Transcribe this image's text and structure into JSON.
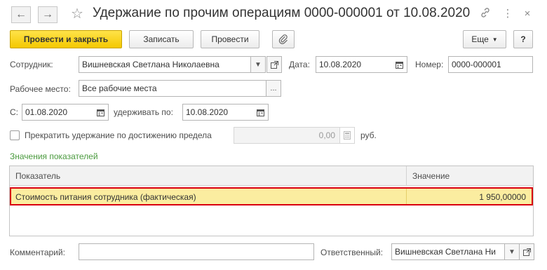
{
  "window": {
    "title": "Удержание по прочим операциям 0000-000001 от 10.08.2020"
  },
  "toolbar": {
    "post_close_label": "Провести и закрыть",
    "save_label": "Записать",
    "post_label": "Провести",
    "more_label": "Еще",
    "help_label": "?"
  },
  "form": {
    "employee_label": "Сотрудник:",
    "employee_value": "Вишневская Светлана Николаевна",
    "date_label": "Дата:",
    "date_value": "10.08.2020",
    "number_label": "Номер:",
    "number_value": "0000-000001",
    "workplace_label": "Рабочее место:",
    "workplace_value": "Все рабочие места",
    "from_label": "С:",
    "from_value": "01.08.2020",
    "withhold_to_label": "удерживать по:",
    "withhold_to_value": "10.08.2020",
    "stop_limit_label": "Прекратить удержание по достижению предела",
    "stop_limit_value": "0,00",
    "currency_label": "руб."
  },
  "indicators": {
    "section_label": "Значения показателей",
    "columns": [
      "Показатель",
      "Значение"
    ],
    "rows": [
      {
        "indicator": "Стоимость питания сотрудника (фактическая)",
        "value": "1 950,00000"
      }
    ]
  },
  "footer": {
    "comment_label": "Комментарий:",
    "comment_value": "",
    "responsible_label": "Ответственный:",
    "responsible_value": "Вишневская Светлана Ни"
  },
  "icons": {
    "back": "arrow-left-icon",
    "forward": "arrow-right-icon",
    "favorite": "star-icon",
    "link": "link-icon",
    "menu": "more-vertical-icon",
    "close": "close-icon",
    "attach": "paperclip-icon",
    "dropdown": "chevron-down-icon",
    "open": "open-form-icon",
    "calendar": "calendar-icon",
    "calculator": "calculator-icon",
    "select": "ellipsis-icon"
  },
  "colors": {
    "primary_button": "#f4c800",
    "highlight_row": "#fbeda0",
    "highlight_border": "#d9000f",
    "section_label": "#4a9a3e"
  }
}
